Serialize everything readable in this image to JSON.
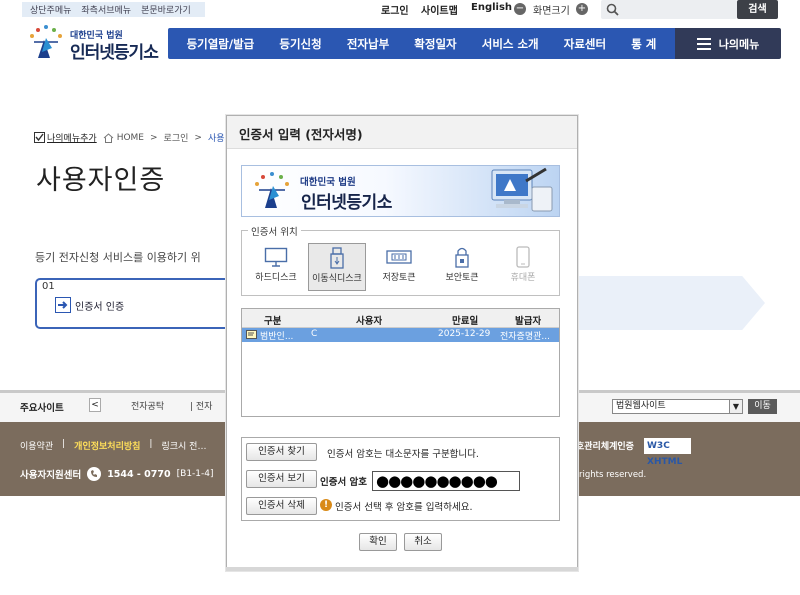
{
  "skip_links": [
    "상단주메뉴",
    "좌측서브메뉴",
    "본문바로가기"
  ],
  "util": {
    "login": "로그인",
    "sitemap": "사이트맵",
    "english": "English",
    "screen_size": "화면크기",
    "search_button": "검색"
  },
  "logo": {
    "sub": "대한민국 법원",
    "main": "인터넷등기소"
  },
  "nav": [
    "등기열람/발급",
    "등기신청",
    "전자납부",
    "확정일자",
    "서비스 소개",
    "자료센터",
    "통 계"
  ],
  "my_menu": "나의메뉴",
  "breadcrumb": {
    "add_my_menu": "나의메뉴추가",
    "home": "HOME",
    "sep": ">",
    "login": "로그인",
    "current": "사용자인…"
  },
  "page": {
    "title": "사용자인증",
    "intro": "등기 전자신청 서비스를 이용하기 위",
    "step_num": "01",
    "step_label": "인증서 인증"
  },
  "sites": {
    "label": "주요사이트",
    "prev": "<",
    "item1": "전자공탁",
    "item2": "| 전자",
    "select": "법원웹사이트",
    "go": "이동"
  },
  "footer": {
    "terms": "이용약관",
    "privacy": "개인정보처리방침",
    "link3": "링크시 전…",
    "support_label": "사용자지원센터",
    "support_phone": "1544 - 0770",
    "support_floor": "[B1-1-4]",
    "cert_mark": "호관리체계인증",
    "w3c": "W3C XHTML",
    "rights": "rights reserved."
  },
  "dialog": {
    "title": "인증서 입력 (전자서명)",
    "banner_sub": "대한민국 법원",
    "banner_main": "인터넷등기소",
    "location_legend": "인증서 위치",
    "locations": [
      {
        "label": "하드디스크",
        "icon": "monitor-icon"
      },
      {
        "label": "이동식디스크",
        "icon": "usb-icon"
      },
      {
        "label": "저장토큰",
        "icon": "token-icon"
      },
      {
        "label": "보안토큰",
        "icon": "lock-icon"
      },
      {
        "label": "휴대폰",
        "icon": "phone-icon"
      }
    ],
    "table": {
      "headers": [
        "구분",
        "사용자",
        "만료일",
        "발급자"
      ],
      "rows": [
        {
          "type": "범반인...",
          "user": "C",
          "expiry": "2025-12-29",
          "issuer": "전자증명관..."
        }
      ]
    },
    "buttons": {
      "find": "인증서 찾기",
      "view": "인증서 보기",
      "delete": "인증서 삭제",
      "ok": "확인",
      "cancel": "취소"
    },
    "case_note": "인증서 암호는 대소문자를 구분합니다.",
    "password_label": "인증서 암호",
    "password_value": "●●●●●●●●●●",
    "warning": "인증서 선택 후 암호를 입력하세요."
  },
  "colors": {
    "nav_blue": "#2b57b2",
    "my_menu": "#313a58",
    "footer": "#7b6c5d",
    "selected_row": "#6ba0e0"
  }
}
